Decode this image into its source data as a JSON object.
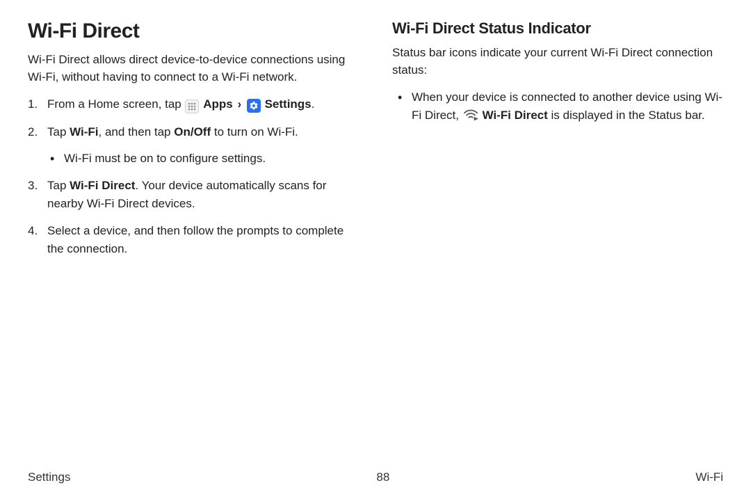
{
  "left": {
    "title": "Wi-Fi Direct",
    "intro": "Wi-Fi Direct allows direct device-to-device connections using Wi-Fi, without having to connect to a Wi-Fi network.",
    "step1_a": "From a Home screen, tap ",
    "step1_apps": "Apps",
    "step1_settings": "Settings",
    "step1_period": ".",
    "step2_a": "Tap ",
    "step2_wifi": "Wi-Fi",
    "step2_b": ", and then tap ",
    "step2_onoff": "On/Off",
    "step2_c": " to turn on Wi-Fi.",
    "step2_sub": "Wi-Fi must be on to configure settings.",
    "step3_a": "Tap ",
    "step3_wfd": "Wi-Fi Direct",
    "step3_b": ". Your device automatically scans for nearby Wi-Fi Direct devices.",
    "step4": "Select a device, and then follow the prompts to complete the connection."
  },
  "right": {
    "title": "Wi-Fi Direct Status Indicator",
    "intro": "Status bar icons indicate your current Wi-Fi Direct connection status:",
    "bullet_a": "When your device is connected to another device using Wi-Fi Direct, ",
    "bullet_label": "Wi-Fi Direct",
    "bullet_b": " is displayed in the Status bar."
  },
  "footer": {
    "left": "Settings",
    "center": "88",
    "right": "Wi-Fi"
  }
}
